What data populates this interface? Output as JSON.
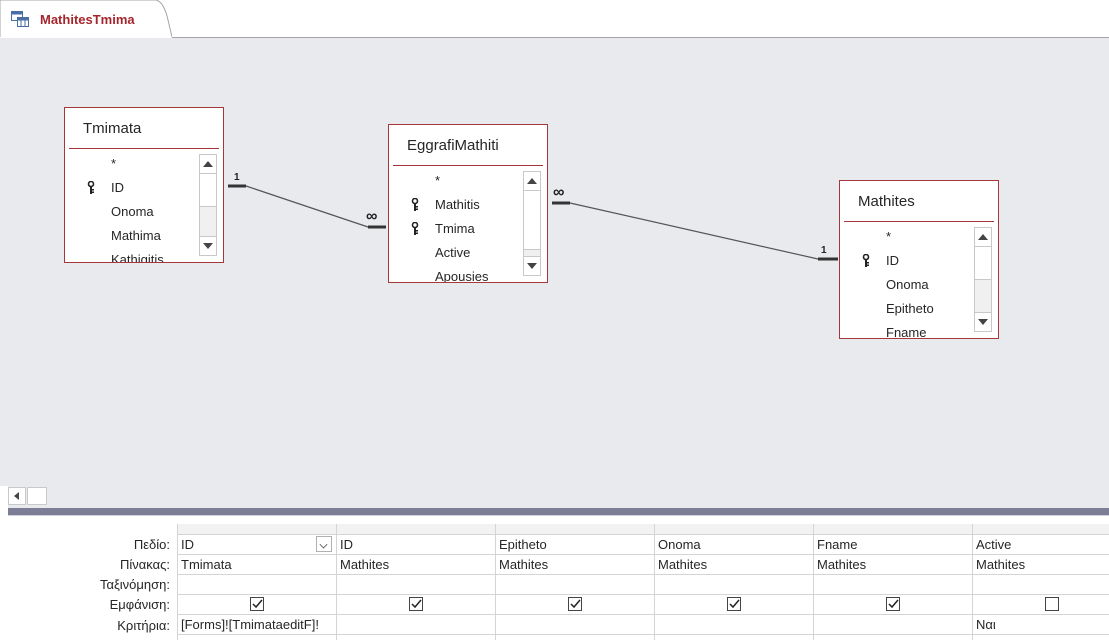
{
  "tab": {
    "title": "MathitesTmima"
  },
  "tables": {
    "tmimata": {
      "name": "Tmimata",
      "fields": [
        "*",
        "ID",
        "Onoma",
        "Mathima",
        "Kathigitis"
      ]
    },
    "eggrafi": {
      "name": "EggrafiMathiti",
      "fields": [
        "*",
        "Mathitis",
        "Tmima",
        "Active",
        "Apousies"
      ]
    },
    "mathites": {
      "name": "Mathites",
      "fields": [
        "*",
        "ID",
        "Onoma",
        "Epitheto",
        "Fname"
      ]
    }
  },
  "relations": [
    {
      "from": "Tmimata",
      "to": "EggrafiMathiti",
      "from_label": "1",
      "to_label": "∞"
    },
    {
      "from": "EggrafiMathiti",
      "to": "Mathites",
      "from_label": "∞",
      "to_label": "1"
    }
  ],
  "grid": {
    "row_labels": [
      "Πεδίο:",
      "Πίνακας:",
      "Ταξινόμηση:",
      "Εμφάνιση:",
      "Κριτήρια:"
    ],
    "columns": [
      {
        "field": "ID",
        "table": "Tmimata",
        "sort": "",
        "show": true,
        "criteria": "[Forms]![TmimataeditF]!"
      },
      {
        "field": "ID",
        "table": "Mathites",
        "sort": "",
        "show": true,
        "criteria": ""
      },
      {
        "field": "Epitheto",
        "table": "Mathites",
        "sort": "",
        "show": true,
        "criteria": ""
      },
      {
        "field": "Onoma",
        "table": "Mathites",
        "sort": "",
        "show": true,
        "criteria": ""
      },
      {
        "field": "Fname",
        "table": "Mathites",
        "sort": "",
        "show": true,
        "criteria": ""
      },
      {
        "field": "Active",
        "table": "Mathites",
        "sort": "",
        "show": false,
        "criteria": "Ναι"
      }
    ]
  }
}
